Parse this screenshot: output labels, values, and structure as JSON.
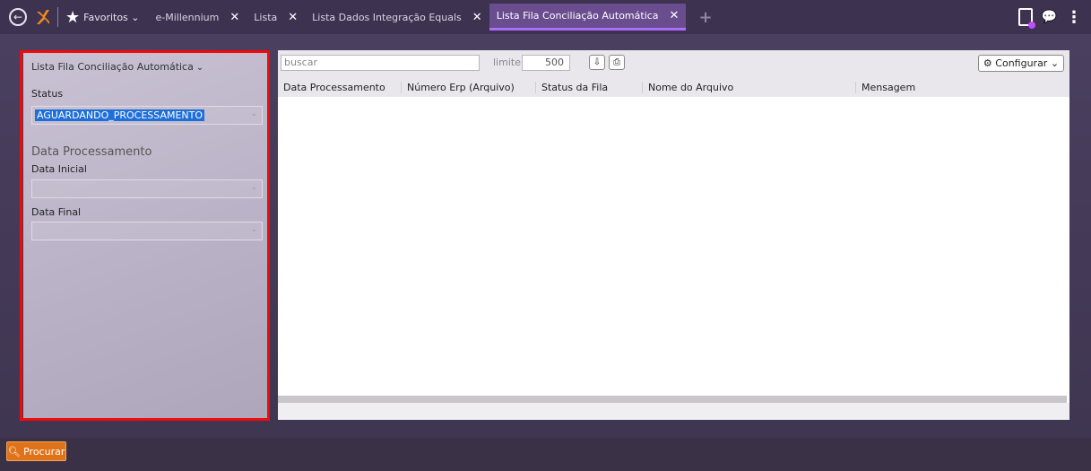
{
  "topbar": {
    "favorites_label": "Favoritos",
    "tabs": [
      {
        "label": "e-Millennium"
      },
      {
        "label": "Lista"
      },
      {
        "label": "Lista Dados Integração Equals"
      },
      {
        "label": "Lista Fila Conciliação Automática"
      }
    ],
    "add_tab": "+",
    "close": "✕"
  },
  "filters": {
    "title": "Lista Fila Conciliação Automática",
    "status_label": "Status",
    "status_value": "AGUARDANDO_PROCESSAMENTO",
    "section_title": "Data Processamento",
    "data_inicial_label": "Data Inicial",
    "data_final_label": "Data Final"
  },
  "toolbar": {
    "search_placeholder": "buscar",
    "limit_label": "limite:",
    "limit_value": "500",
    "config_label": "Configurar"
  },
  "table": {
    "columns": [
      "Data Processamento",
      "Número Erp (Arquivo)",
      "Status da Fila",
      "Nome do Arquivo",
      "Mensagem"
    ]
  },
  "footer": {
    "search_button": "Procurar"
  },
  "colors": {
    "accent": "#6a4d8e",
    "highlight": "#f00a0a",
    "button": "#e0731a"
  }
}
